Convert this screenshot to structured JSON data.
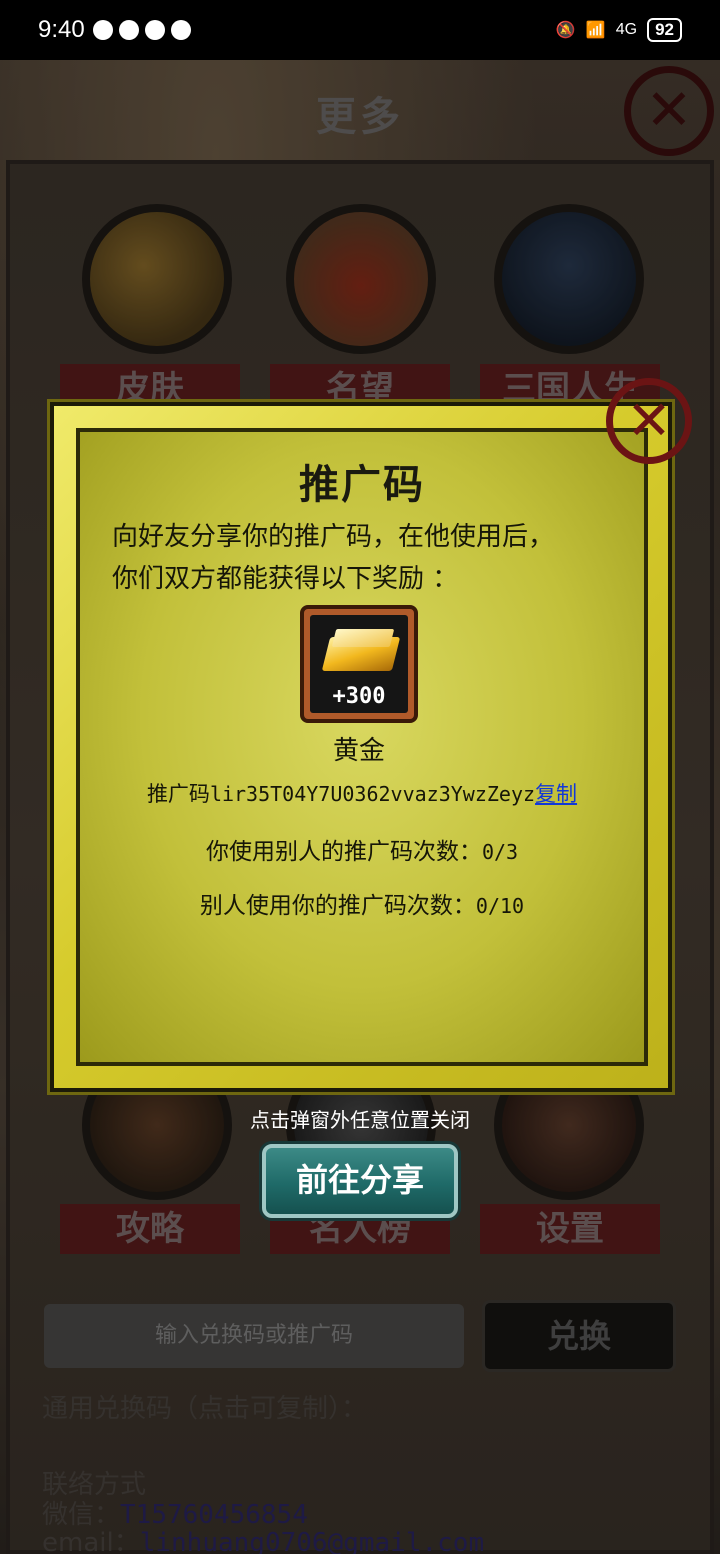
{
  "status_bar": {
    "time": "9:40",
    "network": "4G",
    "battery": "92"
  },
  "background": {
    "title": "更多",
    "menu": [
      {
        "label": "皮肤"
      },
      {
        "label": "名望"
      },
      {
        "label": "三国人生"
      },
      {
        "label": "攻略"
      },
      {
        "label": "名人榜"
      },
      {
        "label": "设置"
      }
    ],
    "redeem_placeholder": "输入兑换码或推广码",
    "redeem_button": "兑换",
    "general_code_label": "通用兑换码（点击可复制）：",
    "contact_title": "联络方式",
    "wechat_label": "微信：",
    "wechat_value": "T15760456854",
    "email_label": "email：",
    "email_value": "linhuang0706@gmail.com"
  },
  "popup": {
    "title": "推广码",
    "description_line1": "向好友分享你的推广码，在他使用后，",
    "description_line2": "你们双方都能获得以下奖励 ：",
    "reward": {
      "amount": "+300",
      "name": "黄金",
      "icon": "gold-bar-icon"
    },
    "code_label": "推广码",
    "code_value": "lir35T04Y7U0362vvaz3YwzZeyz",
    "copy_label": "复制",
    "used_others_label": "你使用别人的推广码次数：",
    "used_others_value": "0/3",
    "others_used_label": "别人使用你的推广码次数：",
    "others_used_value": "0/10"
  },
  "tip": "点击弹窗外任意位置关闭",
  "share_button": "前往分享",
  "colors": {
    "popup_frame": "#d6cb2c",
    "share_button": "#1f6a68",
    "copy_link": "#1238d8",
    "close_brush": "#6b1414"
  }
}
